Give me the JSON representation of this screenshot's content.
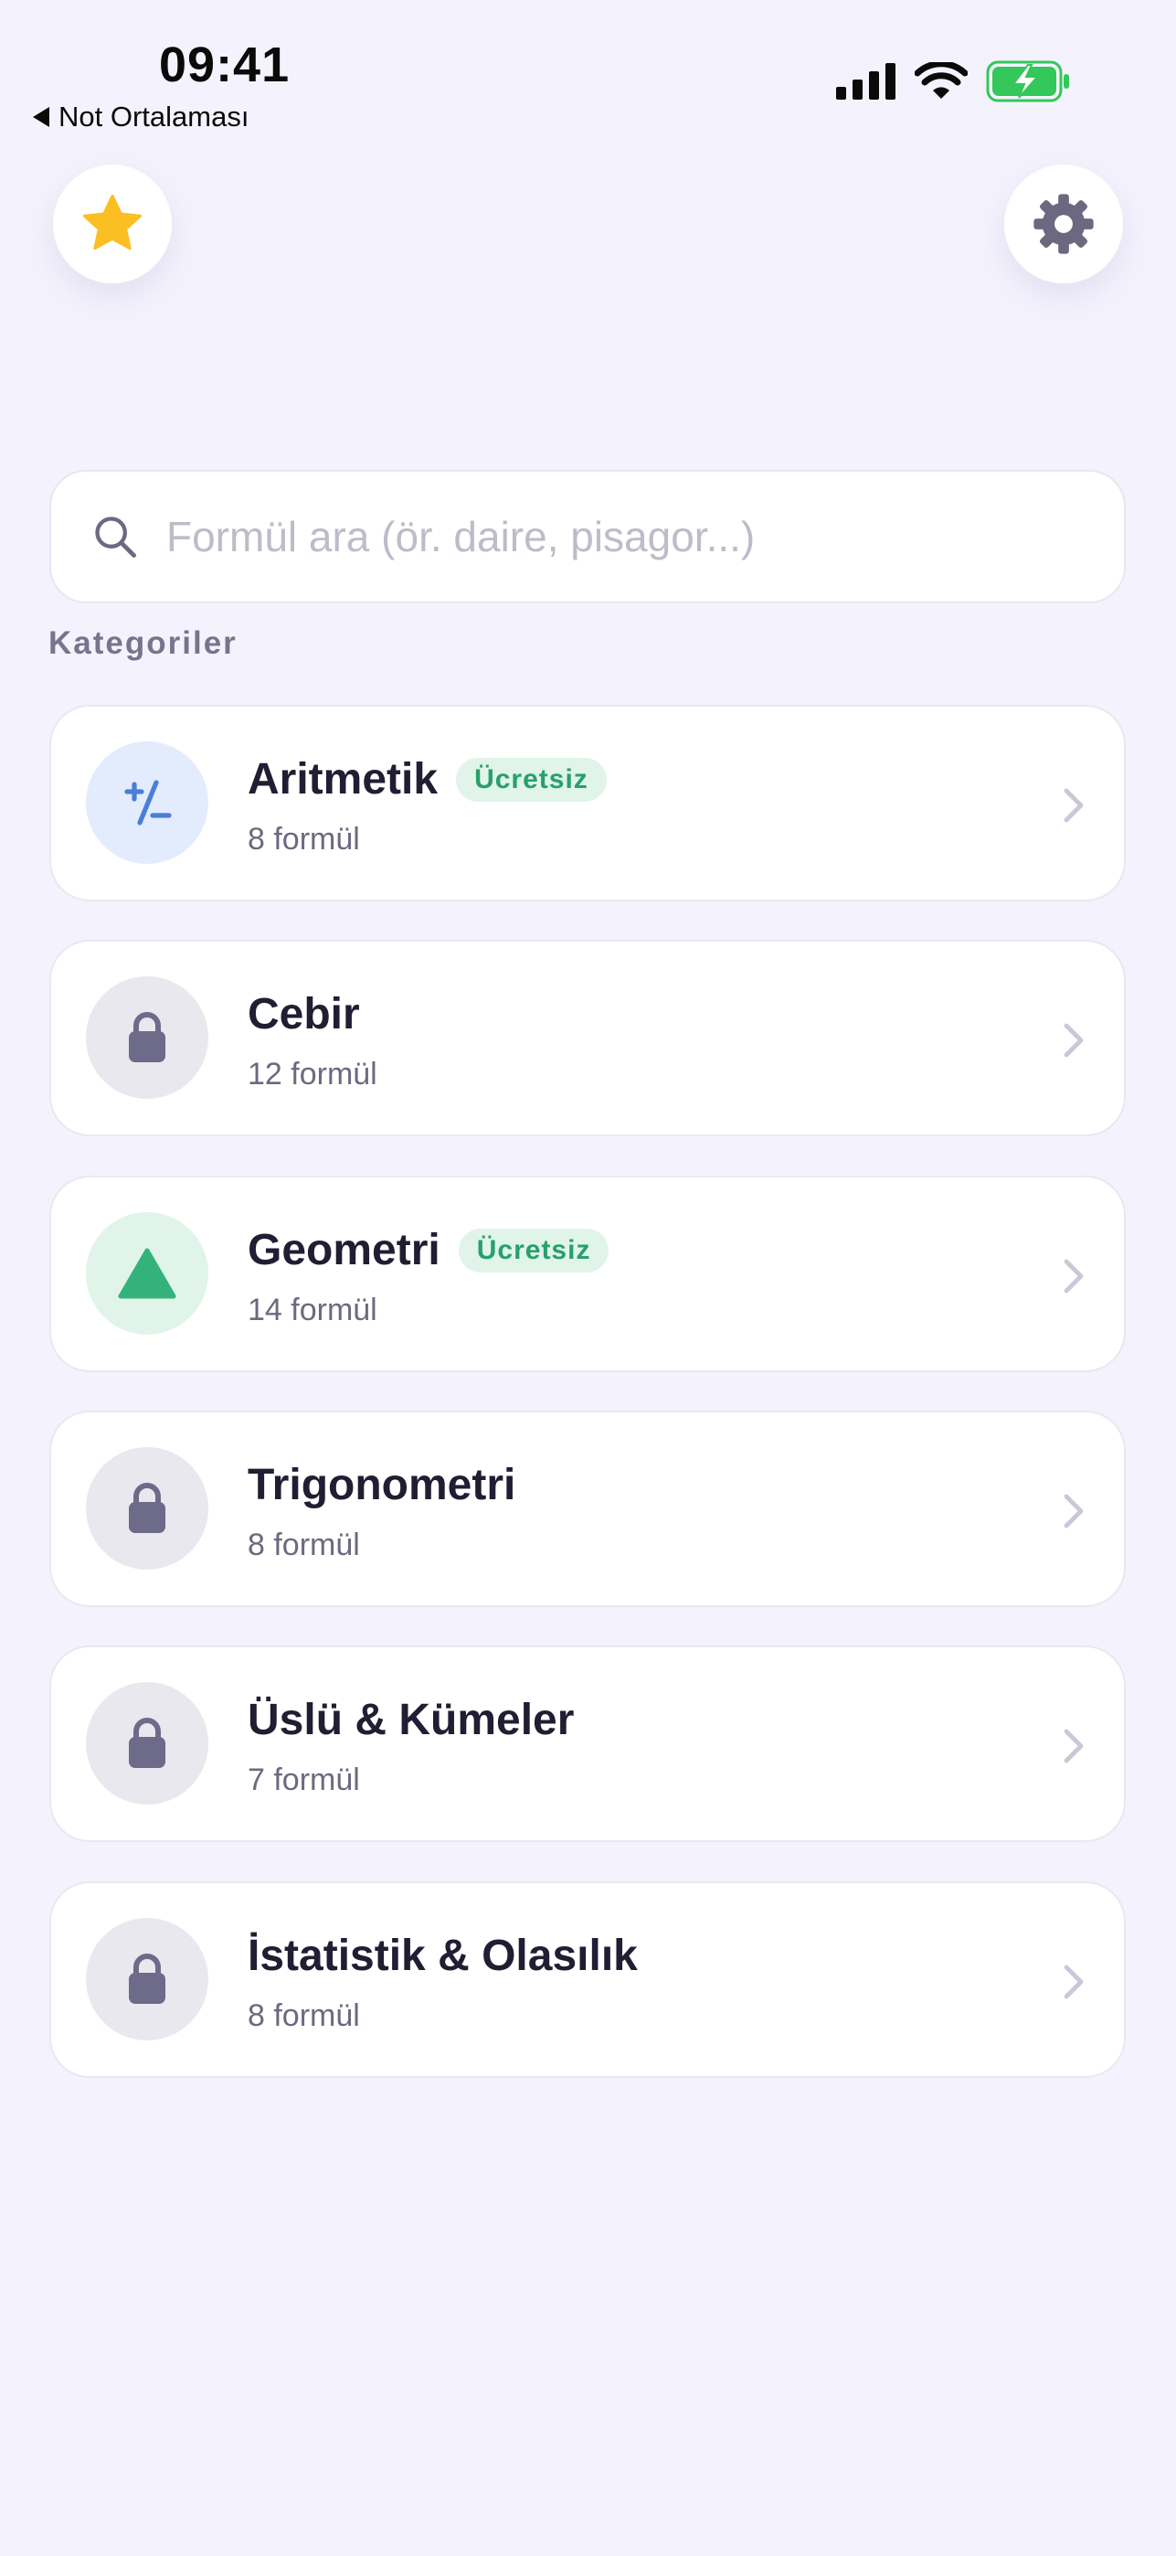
{
  "status_bar": {
    "time": "09:41",
    "back_label": "Not Ortalaması",
    "icons": [
      "signal-icon",
      "wifi-icon",
      "battery-charging-icon"
    ],
    "battery_color": "#34c759"
  },
  "header": {
    "favorites_icon": "star-icon",
    "settings_icon": "gear-icon"
  },
  "search": {
    "placeholder": "Formül ara (ör. daire, pisagor...)",
    "value": ""
  },
  "categories_title": "Kategoriler",
  "categories": [
    {
      "name": "Aritmetik",
      "count": "8 formül",
      "badge": "Ücretsiz",
      "icon": "plus-minus-icon",
      "locked": false
    },
    {
      "name": "Cebir",
      "count": "12 formül",
      "badge": "",
      "icon": "lock-icon",
      "locked": true
    },
    {
      "name": "Geometri",
      "count": "14 formül",
      "badge": "Ücretsiz",
      "icon": "triangle-icon",
      "locked": false
    },
    {
      "name": "Trigonometri",
      "count": "8 formül",
      "badge": "",
      "icon": "lock-icon",
      "locked": true
    },
    {
      "name": "Üslü & Kümeler",
      "count": "7 formül",
      "badge": "",
      "icon": "lock-icon",
      "locked": true
    },
    {
      "name": "İstatistik & Olasılık",
      "count": "8 formül",
      "badge": "",
      "icon": "lock-icon",
      "locked": true
    }
  ],
  "colors": {
    "background": "#f4f3fd",
    "accent_star": "#fbbf24",
    "free_badge": "#27a06a",
    "lock": "#6e6a8a",
    "arithmetic": "#4a7fd9",
    "geometry": "#34b27b"
  }
}
